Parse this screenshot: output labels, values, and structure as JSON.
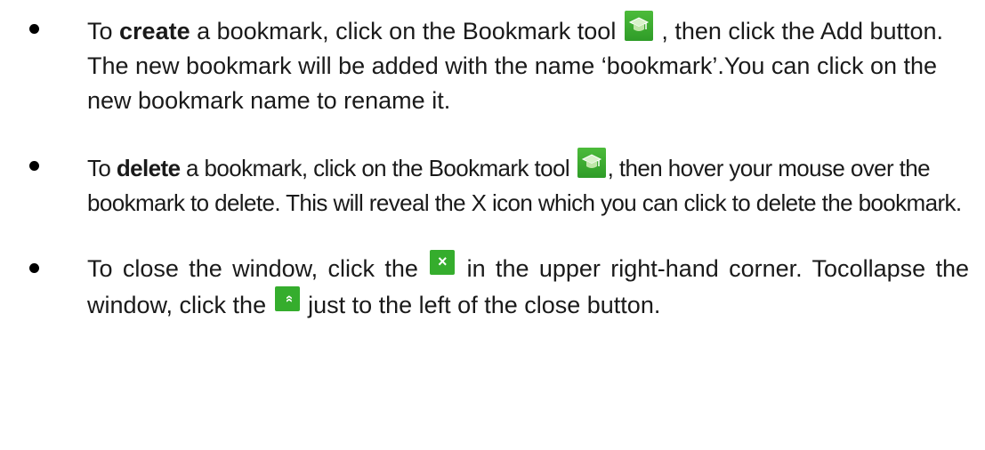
{
  "bullets": [
    {
      "pre": "To ",
      "bold": "create",
      "mid": " a bookmark, click on the Bookmark tool ",
      "post": " , then click the Add button. The new bookmark will be added with the name ‘bookmark’.You can click on the new bookmark name to rename it."
    },
    {
      "pre": "To ",
      "bold": "delete",
      "mid": " a bookmark, click on the Bookmark tool ",
      "post": ", then hover your mouse over the bookmark to delete. This will reveal the X icon which you can click to delete the bookmark."
    },
    {
      "pre": "To close the window, click the ",
      "mid": " in the upper right-hand corner. Tocollapse the window, click the ",
      "post": " just to the left of the close button."
    }
  ],
  "icons": {
    "bookmark": "bookmark-tool-icon",
    "close": "close-icon",
    "collapse": "collapse-icon",
    "close_glyph": "×",
    "collapse_glyph": "«"
  },
  "colors": {
    "icon_green": "#35ad2d",
    "text": "#1a1a1a"
  }
}
